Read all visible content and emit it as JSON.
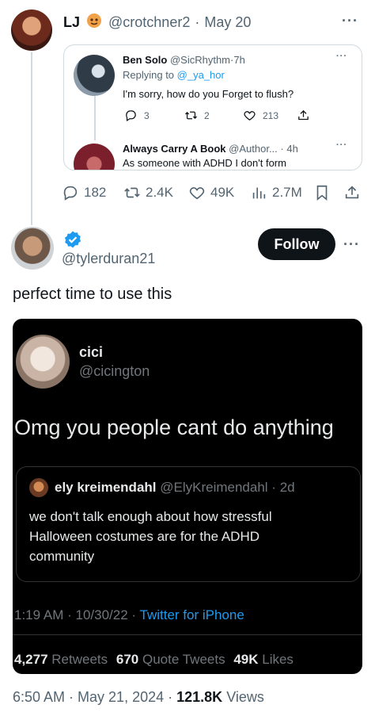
{
  "reply": {
    "name": "LJ",
    "handle": "@crotchner2",
    "date": "May 20",
    "menu": "···",
    "quoted_thread": {
      "first": {
        "name": "Ben Solo",
        "handle": "@SicRhythm",
        "time": "7h",
        "replying_prefix": "Replying to",
        "replying_to": "@_ya_hor",
        "text": "I'm sorry, how do you Forget to flush?",
        "replies": "3",
        "retweets": "2",
        "likes": "213",
        "menu": "···"
      },
      "second": {
        "name": "Always Carry A Book",
        "handle": "@Author...",
        "time": "4h",
        "text": "As someone with ADHD I don't form",
        "menu": "···"
      }
    },
    "metrics": {
      "replies": "182",
      "retweets": "2.4K",
      "likes": "49K",
      "views": "2.7M"
    }
  },
  "main": {
    "handle": "@tylerduran21",
    "follow_label": "Follow",
    "menu": "···",
    "text": "perfect time to use this",
    "embedded": {
      "name": "cici",
      "handle": "@cicington",
      "text": "Omg you people cant do anything",
      "quote": {
        "name": "ely kreimendahl",
        "handle": "@ElyKreimendahl",
        "time": "2d",
        "text_lines": [
          "we don't talk enough about how stressful",
          "Halloween costumes are for the ADHD",
          "community"
        ]
      },
      "time": "1:19 AM",
      "date": "10/30/22",
      "source": "Twitter for iPhone",
      "retweets_count": "4,277",
      "retweets_label": "Retweets",
      "quotes_count": "670",
      "quotes_label": "Quote Tweets",
      "likes_count": "49K",
      "likes_label": "Likes"
    },
    "timestamp": "6:50 AM · May 21, 2024",
    "views_count": "121.8K",
    "views_label": "Views"
  },
  "colors": {
    "accent": "#1d9bf0",
    "muted": "#536471",
    "border": "#cfd9de"
  }
}
